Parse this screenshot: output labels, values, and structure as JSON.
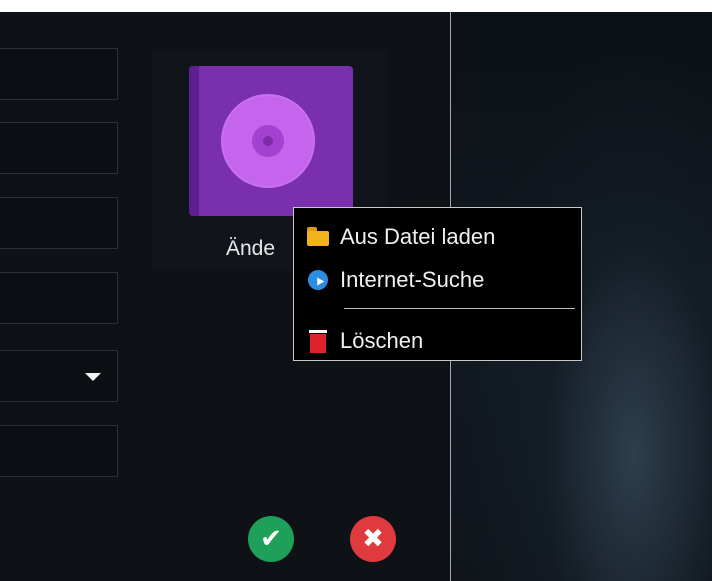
{
  "cover": {
    "change_label": "Ände"
  },
  "context_menu": {
    "items": [
      {
        "label": "Aus Datei laden",
        "icon": "folder-icon"
      },
      {
        "label": "Internet-Suche",
        "icon": "globe-search-icon"
      },
      {
        "label": "Löschen",
        "icon": "trash-icon"
      }
    ]
  },
  "buttons": {
    "ok_glyph": "✔",
    "cancel_glyph": "✖"
  },
  "colors": {
    "ok": "#1fa05a",
    "cancel": "#e03a3e",
    "cover": "#7a2fae",
    "disc": "#c565ee"
  }
}
